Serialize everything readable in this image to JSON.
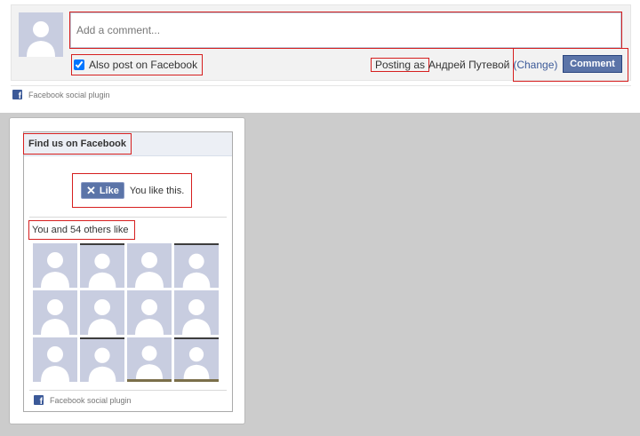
{
  "comments": {
    "placeholder": "Add a comment...",
    "also_post_label": "Also post on Facebook",
    "also_post_checked": true,
    "posting_as_label": "Posting as",
    "user_name": "Андрей Путевой",
    "change_label": "(Change)",
    "submit_label": "Comment",
    "footer_label": "Facebook social plugin"
  },
  "fanbox": {
    "title": "Find us on Facebook",
    "like_button_label": "Like",
    "like_status": "You like this.",
    "others_like": "You and 54 others like",
    "friend_count_shown": 12,
    "footer_label": "Facebook social plugin"
  },
  "colors": {
    "facebook_blue": "#3b5998",
    "button_blue": "#5b74a8",
    "highlight_red": "#d61f1f",
    "avatar_bg": "#c8cde0"
  },
  "icons": [
    "avatar-silhouette-icon",
    "facebook-logo-icon",
    "close-x-icon",
    "checkbox-icon"
  ]
}
